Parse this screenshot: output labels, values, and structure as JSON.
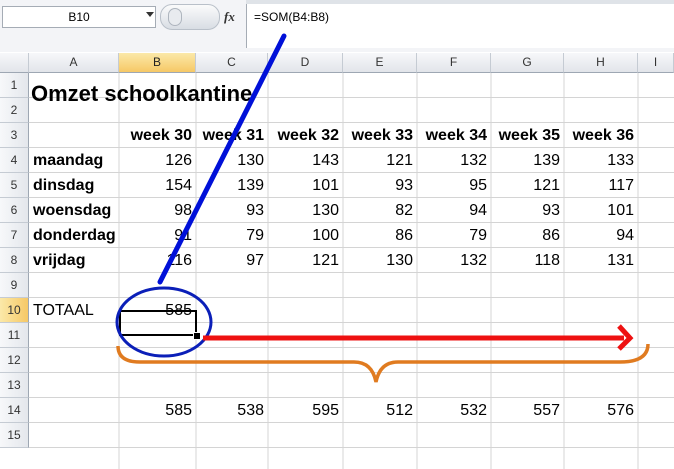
{
  "formula_bar": {
    "name_box": "B10",
    "fx_label": "fx",
    "formula": "=SOM(B4:B8)"
  },
  "columns": [
    "A",
    "B",
    "C",
    "D",
    "E",
    "F",
    "G",
    "H",
    "I"
  ],
  "selected_column": "B",
  "rows": [
    "1",
    "2",
    "3",
    "4",
    "5",
    "6",
    "7",
    "8",
    "9",
    "10",
    "11",
    "12",
    "13",
    "14",
    "15"
  ],
  "selected_row": "10",
  "sheet": {
    "title": "Omzet schoolkantine",
    "weeks": [
      "week 30",
      "week 31",
      "week 32",
      "week 33",
      "week 34",
      "week 35",
      "week 36"
    ],
    "days": [
      {
        "label": "maandag",
        "values": [
          "126",
          "130",
          "143",
          "121",
          "132",
          "139",
          "133"
        ]
      },
      {
        "label": "dinsdag",
        "values": [
          "154",
          "139",
          "101",
          "93",
          "95",
          "121",
          "117"
        ]
      },
      {
        "label": "woensdag",
        "values": [
          "98",
          "93",
          "130",
          "82",
          "94",
          "93",
          "101"
        ]
      },
      {
        "label": "donderdag",
        "values": [
          "91",
          "79",
          "100",
          "86",
          "79",
          "86",
          "94"
        ]
      },
      {
        "label": "vrijdag",
        "values": [
          "116",
          "97",
          "121",
          "130",
          "132",
          "118",
          "131"
        ]
      }
    ],
    "total_label": "TOTAAL",
    "total_value": "585",
    "totals_row": [
      "585",
      "538",
      "595",
      "512",
      "532",
      "557",
      "576"
    ]
  },
  "annotation_colors": {
    "line": "#0010d8",
    "ellipse": "#0b1fb8",
    "arrow": "#ee1111",
    "brace": "#e07b20"
  }
}
